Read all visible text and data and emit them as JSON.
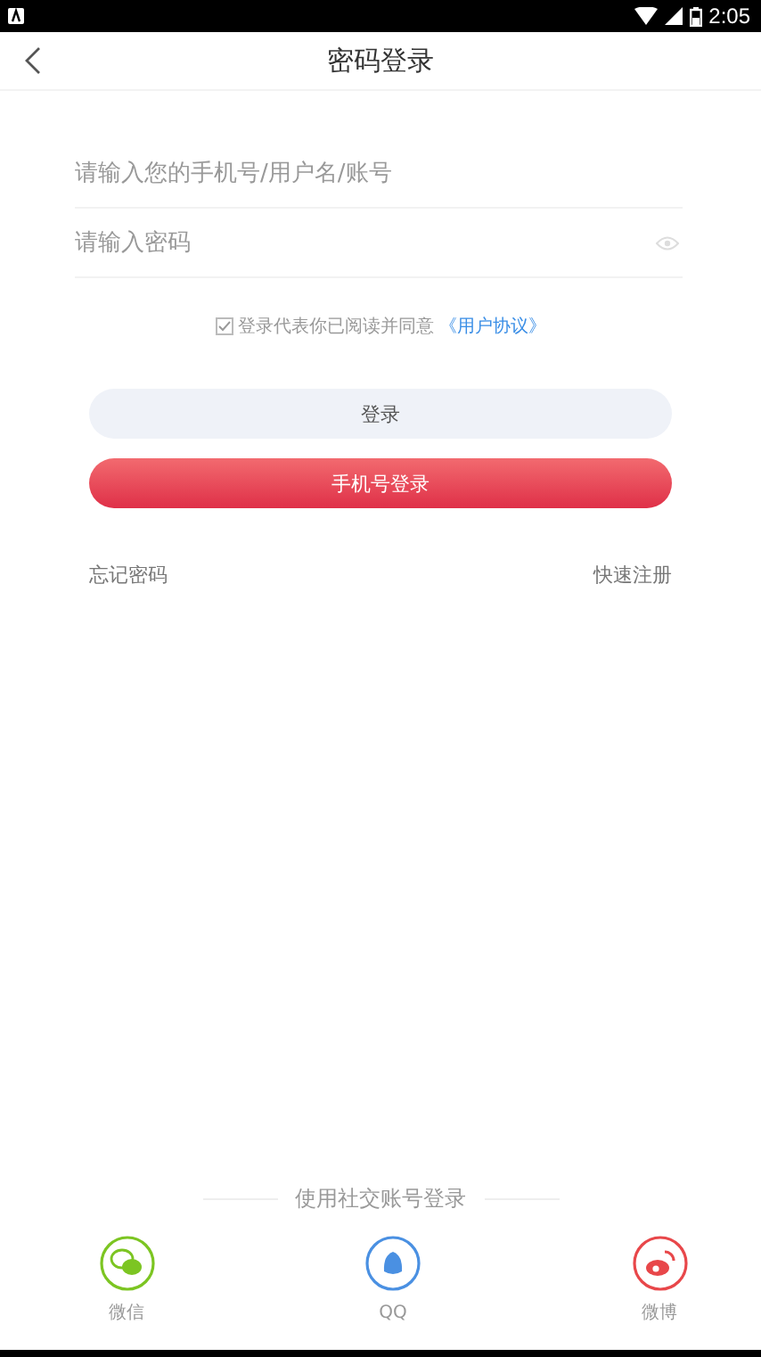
{
  "status_bar": {
    "time": "2:05"
  },
  "header": {
    "title": "密码登录"
  },
  "fields": [
    {
      "kind": "text",
      "placeholder": "请输入您的手机号/用户名/账号"
    },
    {
      "kind": "password",
      "placeholder": "请输入密码"
    }
  ],
  "agreement": {
    "checked": true,
    "text": "登录代表你已阅读并同意",
    "link": "《用户协议》"
  },
  "buttons": [
    {
      "kind": "plain",
      "label": "登录"
    },
    {
      "kind": "primary",
      "label": "手机号登录"
    }
  ],
  "links": [
    "忘记密码",
    "快速注册"
  ],
  "social": {
    "heading": "使用社交账号登录",
    "items": [
      {
        "kind": "wechat",
        "label": "微信",
        "color": "#7cc522"
      },
      {
        "kind": "qq",
        "label": "QQ",
        "color": "#4a90e2"
      },
      {
        "kind": "weibo",
        "label": "微博",
        "color": "#e8474a"
      }
    ]
  }
}
